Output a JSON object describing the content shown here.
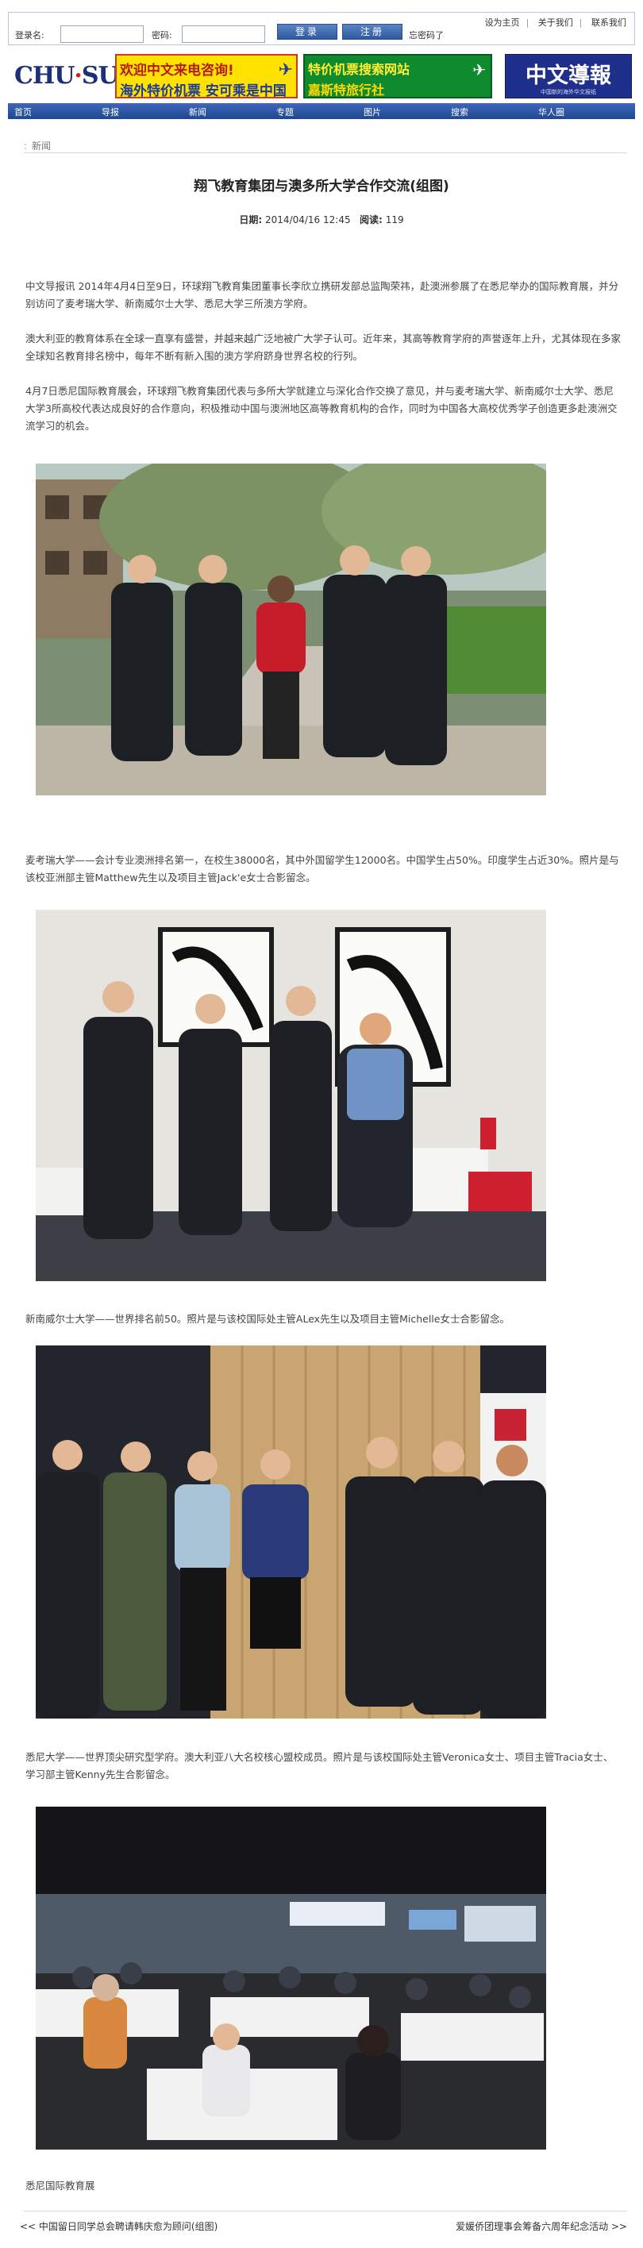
{
  "login": {
    "username_label": "登录名:",
    "password_label": "密码:",
    "login_button": "登录",
    "register_button": "注册",
    "forgot_link": "忘密码了"
  },
  "top_links": [
    "设为主页",
    "关于我们",
    "联系我们"
  ],
  "logo": {
    "text_left": "CHU",
    "text_right": "SUN"
  },
  "banners": {
    "ad1": {
      "line1": "欢迎中文来电咨询!",
      "line2": "海外特价机票 安可乘是中国",
      "icon": "airplane-icon"
    },
    "ad2": {
      "line1": "特价机票搜索网站",
      "line2": "嘉斯特旅行社",
      "icon": "airplane-icon"
    },
    "ad3": {
      "line1": "中文導報",
      "line2": "中国新的海外华文报纸"
    }
  },
  "nav": [
    "首页",
    "导报",
    "新闻",
    "专题",
    "图片",
    "搜索",
    "华人圈"
  ],
  "breadcrumb": {
    "dots": ":",
    "section": "新闻"
  },
  "article": {
    "title": "翔飞教育集团与澳多所大学合作交流(组图)",
    "date_label": "日期:",
    "date": "2014/04/16 12:45",
    "views_label": "阅读:",
    "views": "119",
    "paragraphs": [
      "中文导报讯 2014年4月4日至9日，环球翔飞教育集团董事长李欣立携研发部总监陶荣祎，赴澳洲参展了在悉尼举办的国际教育展，并分别访问了麦考瑞大学、新南威尔士大学、悉尼大学三所澳方学府。",
      "澳大利亚的教育体系在全球一直享有盛誉，并越来越广泛地被广大学子认可。近年来，其高等教育学府的声誉逐年上升，尤其体现在多家全球知名教育排名榜中，每年不断有新入围的澳方学府跻身世界名校的行列。",
      "4月7日悉尼国际教育展会，环球翔飞教育集团代表与多所大学就建立与深化合作交换了意见，并与麦考瑞大学、新南威尔士大学、悉尼大学3所高校代表达成良好的合作意向，积极推动中国与澳洲地区高等教育机构的合作，同时为中国各大高校优秀学子创造更多赴澳洲交流学习的机会。"
    ],
    "captions": [
      "麦考瑞大学——会计专业澳洲排名第一，在校生38000名，其中外国留学生12000名。中国学生占50%。印度学生占近30%。照片是与该校亚洲部主管Matthew先生以及项目主管Jack'e女士合影留念。",
      "新南威尔士大学——世界排名前50。照片是与该校国际处主管ALex先生以及项目主管Michelle女士合影留念。",
      "悉尼大学——世界顶尖研究型学府。澳大利亚八大名校核心盟校成员。照片是与该校国际处主管Veronica女士、项目主管Tracia女士、学习部主管Kenny先生合影留念。",
      "悉尼国际教育展"
    ]
  },
  "pager": {
    "prev": "<< 中国留日同学总会聘请韩庆愈为顾问(组图)",
    "next": "爱媛侨团理事会筹备六周年纪念活动 >>"
  },
  "colors": {
    "nav_bg": "#2f5aa6",
    "button_bg": "#3f6db5",
    "accent_red": "#d61d24"
  }
}
